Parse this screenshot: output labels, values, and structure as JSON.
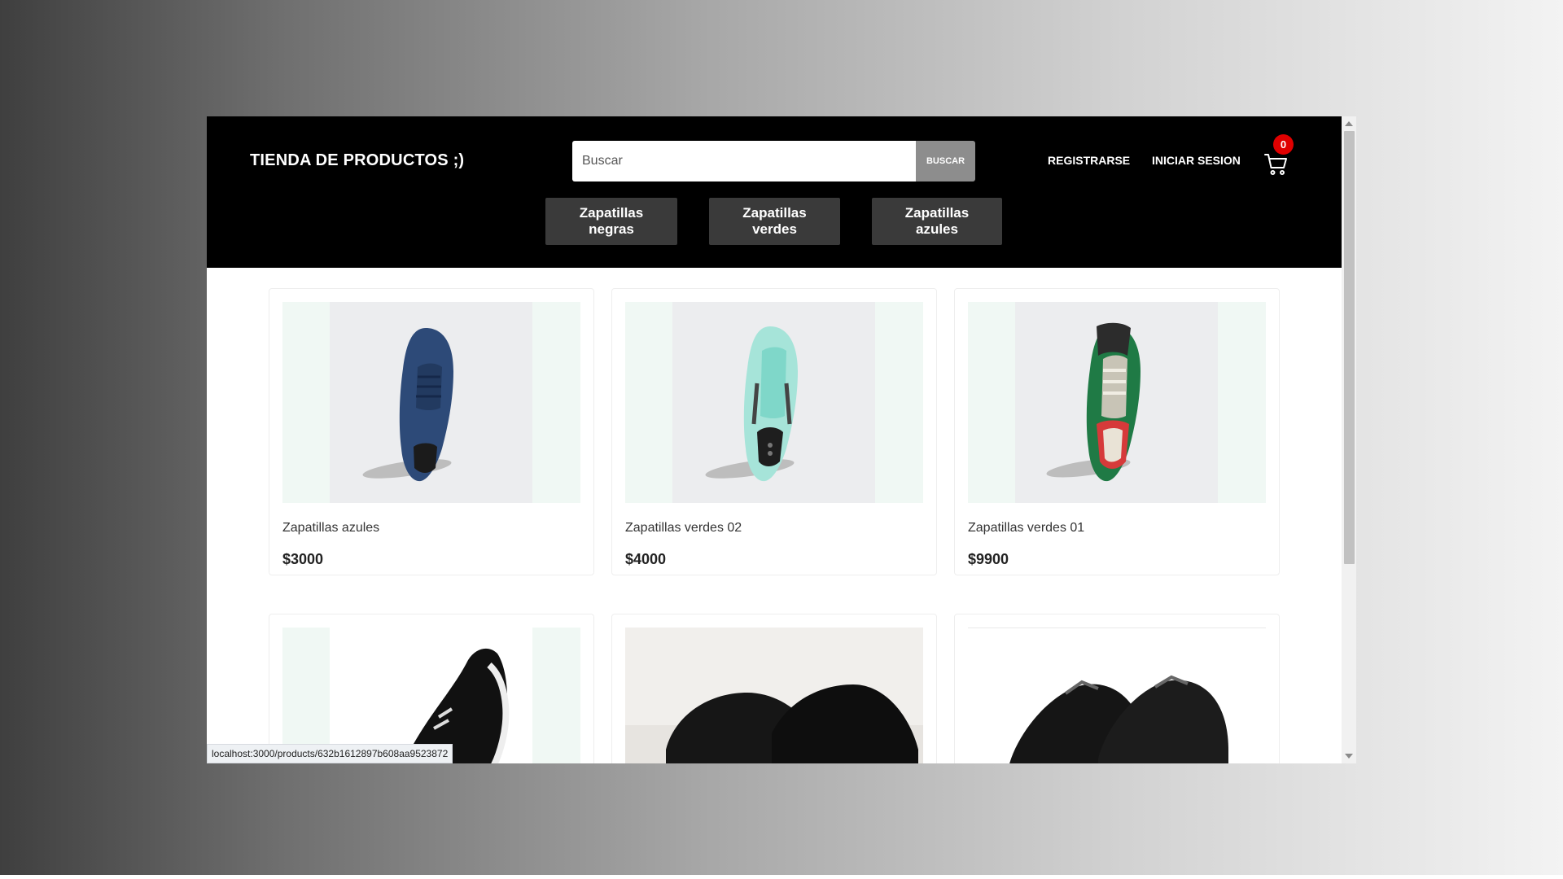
{
  "header": {
    "brand": "TIENDA DE PRODUCTOS ;)",
    "search": {
      "placeholder": "Buscar",
      "value": "",
      "button_label": "BUSCAR"
    },
    "links": {
      "register": "REGISTRARSE",
      "login": "INICIAR SESION"
    },
    "cart": {
      "count": "0",
      "icon": "cart-icon"
    }
  },
  "categories": [
    "Zapatillas negras",
    "Zapatillas verdes",
    "Zapatillas azules"
  ],
  "products": [
    {
      "name": "Zapatillas azules",
      "price": "$3000",
      "image": "blue-sneaker"
    },
    {
      "name": "Zapatillas verdes 02",
      "price": "$4000",
      "image": "mint-sneaker"
    },
    {
      "name": "Zapatillas verdes 01",
      "price": "$9900",
      "image": "green-sneaker"
    },
    {
      "name": "",
      "price": "",
      "image": "black-running-sneaker"
    },
    {
      "name": "",
      "price": "",
      "image": "black-leather-sneakers"
    },
    {
      "name": "",
      "price": "",
      "image": "black-low-sneakers"
    }
  ],
  "status_bar": {
    "url": "localhost:3000/products/632b1612897b608aa9523872"
  },
  "colors": {
    "navbar": "#000000",
    "category_button": "#3a3a3a",
    "search_button": "#8d8d8d",
    "badge": "#e00000"
  }
}
